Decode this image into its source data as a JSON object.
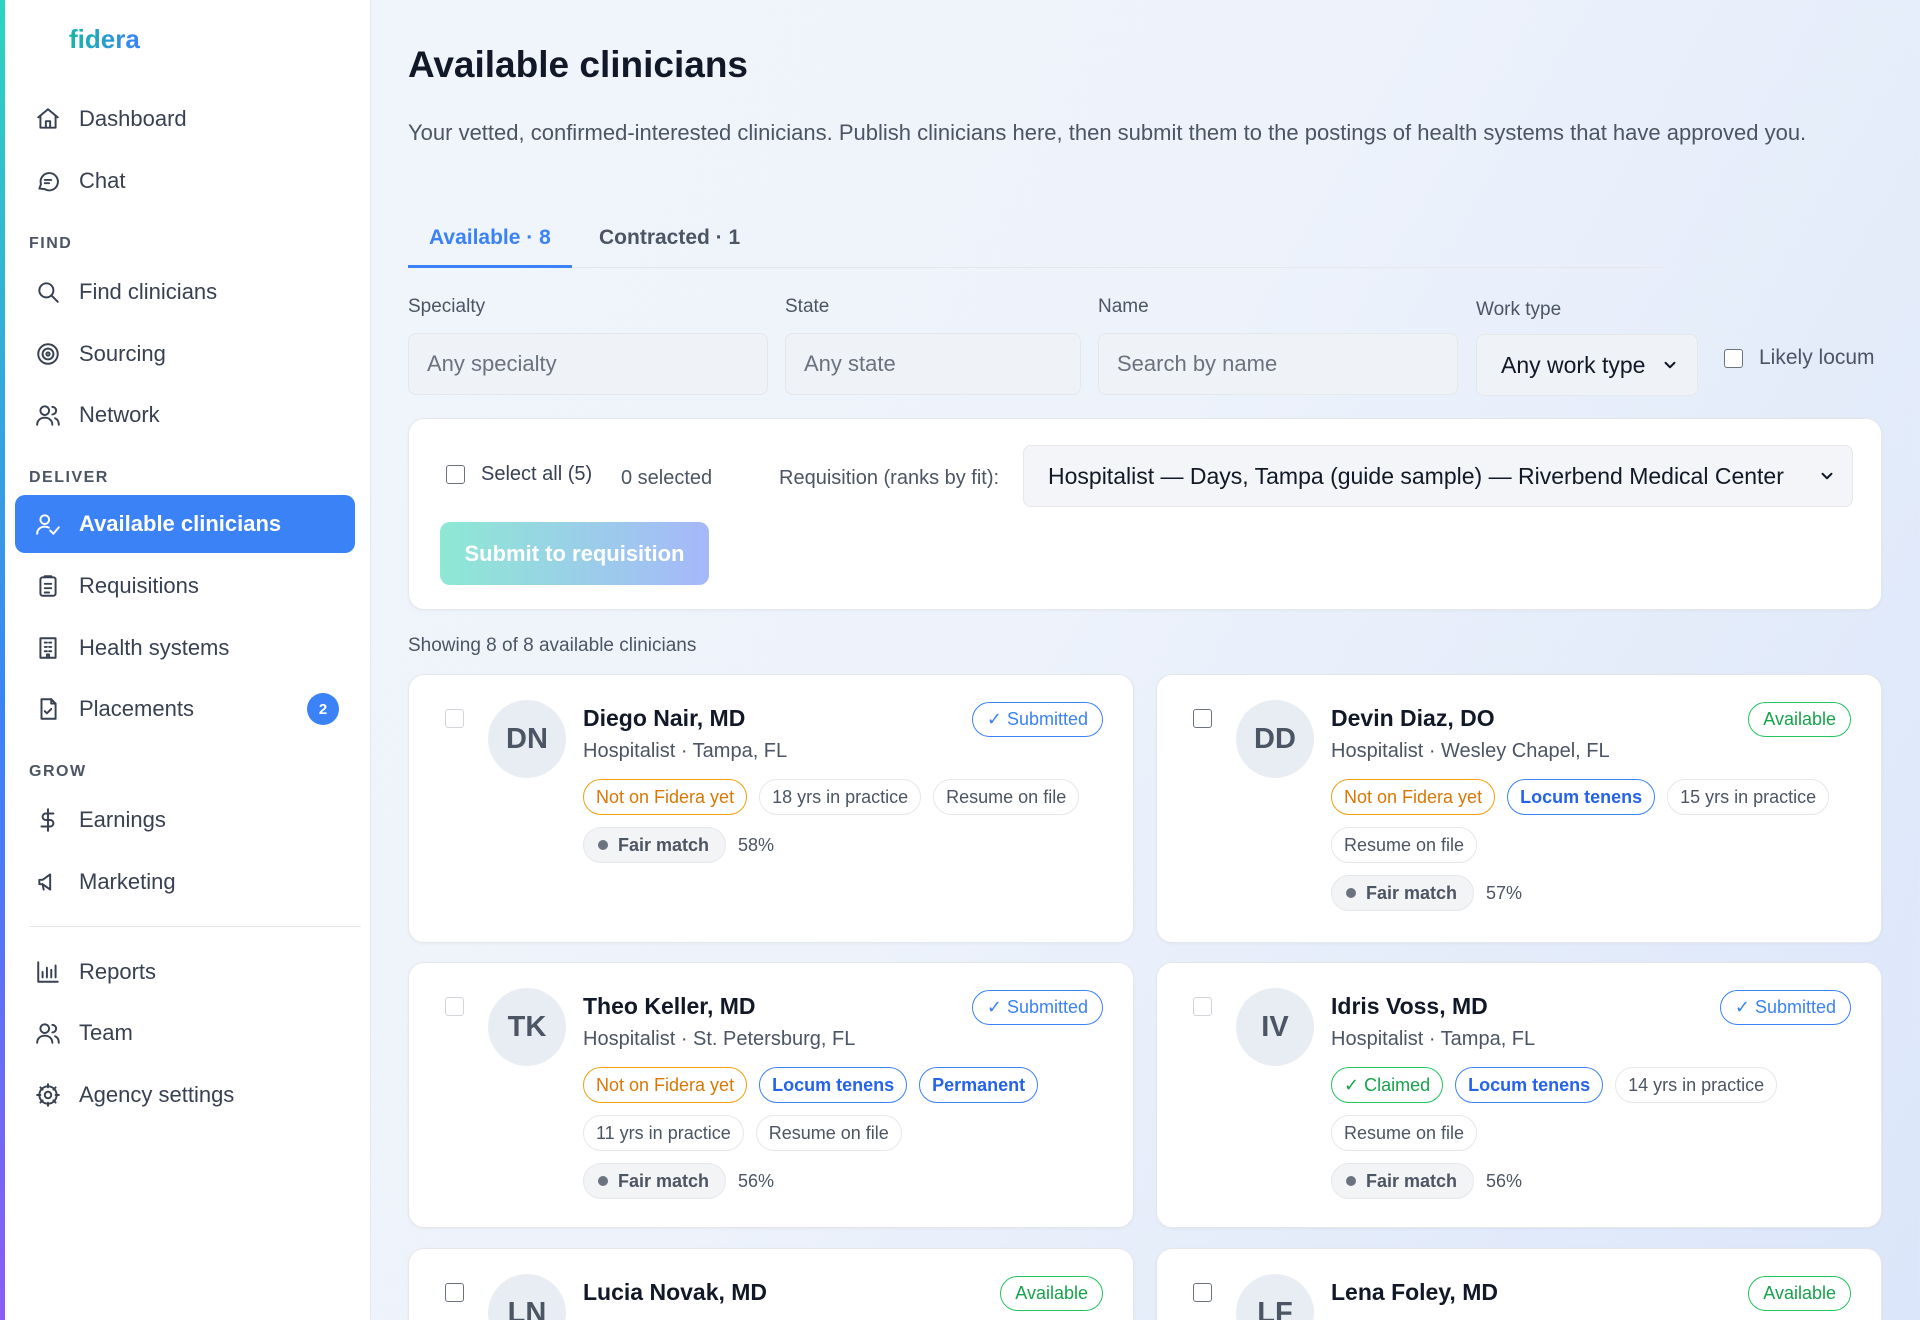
{
  "brand": "fidera",
  "sidebar": {
    "top": [
      {
        "label": "Dashboard",
        "icon": "home-icon"
      },
      {
        "label": "Chat",
        "icon": "chat-icon"
      }
    ],
    "sections": {
      "find": "FIND",
      "deliver": "DELIVER",
      "grow": "GROW"
    },
    "find": [
      {
        "label": "Find clinicians",
        "icon": "search-icon"
      },
      {
        "label": "Sourcing",
        "icon": "target-icon"
      },
      {
        "label": "Network",
        "icon": "users-icon"
      }
    ],
    "deliver": [
      {
        "label": "Available clinicians",
        "icon": "user-check-icon",
        "active": true
      },
      {
        "label": "Requisitions",
        "icon": "clipboard-icon"
      },
      {
        "label": "Health systems",
        "icon": "building-icon"
      },
      {
        "label": "Placements",
        "icon": "file-check-icon",
        "badge": "2"
      }
    ],
    "grow": [
      {
        "label": "Earnings",
        "icon": "dollar-icon"
      },
      {
        "label": "Marketing",
        "icon": "megaphone-icon"
      }
    ],
    "bottom": [
      {
        "label": "Reports",
        "icon": "bar-chart-icon"
      },
      {
        "label": "Team",
        "icon": "team-icon"
      },
      {
        "label": "Agency settings",
        "icon": "settings-icon"
      }
    ]
  },
  "page": {
    "title": "Available clinicians",
    "subtitle": "Your vetted, confirmed-interested clinicians. Publish clinicians here, then submit them to the postings of health systems that have approved you."
  },
  "tabs": [
    {
      "label": "Available · 8",
      "active": true
    },
    {
      "label": "Contracted · 1",
      "active": false
    }
  ],
  "filters": {
    "specialty": {
      "label": "Specialty",
      "placeholder": "Any specialty"
    },
    "state": {
      "label": "State",
      "placeholder": "Any state"
    },
    "name": {
      "label": "Name",
      "placeholder": "Search by name"
    },
    "work_type": {
      "label": "Work type",
      "value": "Any work type"
    },
    "likely_locum": "Likely locum"
  },
  "actions": {
    "select_all": "Select all (5)",
    "selected_count": "0 selected",
    "requisition_label": "Requisition (ranks by fit):",
    "requisition_value": "Hospitalist — Days, Tampa (guide sample) — Riverbend Medical Center",
    "submit_label": "Submit to requisition"
  },
  "showing": "Showing 8 of 8 available clinicians",
  "colors": {
    "accent": "#3b82f6",
    "available": "#22c55e",
    "not_on_fidera": "#f59e0b"
  },
  "cards": [
    {
      "initials": "DN",
      "name": "Diego Nair, MD",
      "sub": "Hospitalist · Tampa, FL",
      "status": "✓ Submitted",
      "tag1": "Not on Fidera yet",
      "tag2": "18 yrs in practice",
      "tag3": "Resume on file",
      "match": "Fair match",
      "pct": "58%"
    },
    {
      "initials": "DD",
      "name": "Devin Diaz, DO",
      "sub": "Hospitalist · Wesley Chapel, FL",
      "status": "Available",
      "tag1": "Not on Fidera yet",
      "tag2": "Locum tenens",
      "tag3": "15 yrs in practice",
      "tag4": "Resume on file",
      "match": "Fair match",
      "pct": "57%"
    },
    {
      "initials": "TK",
      "name": "Theo Keller, MD",
      "sub": "Hospitalist · St. Petersburg, FL",
      "status": "✓ Submitted",
      "tag1": "Not on Fidera yet",
      "tag2": "Locum tenens",
      "tag3": "Permanent",
      "tag4": "11 yrs in practice",
      "tag5": "Resume on file",
      "match": "Fair match",
      "pct": "56%"
    },
    {
      "initials": "IV",
      "name": "Idris Voss, MD",
      "sub": "Hospitalist · Tampa, FL",
      "status": "✓ Submitted",
      "tag1": "✓ Claimed",
      "tag2": "Locum tenens",
      "tag3": "14 yrs in practice",
      "tag4": "Resume on file",
      "match": "Fair match",
      "pct": "56%"
    },
    {
      "initials": "LN",
      "name": "Lucia Novak, MD",
      "status": "Available"
    },
    {
      "initials": "LF",
      "name": "Lena Foley, MD",
      "status": "Available"
    }
  ]
}
